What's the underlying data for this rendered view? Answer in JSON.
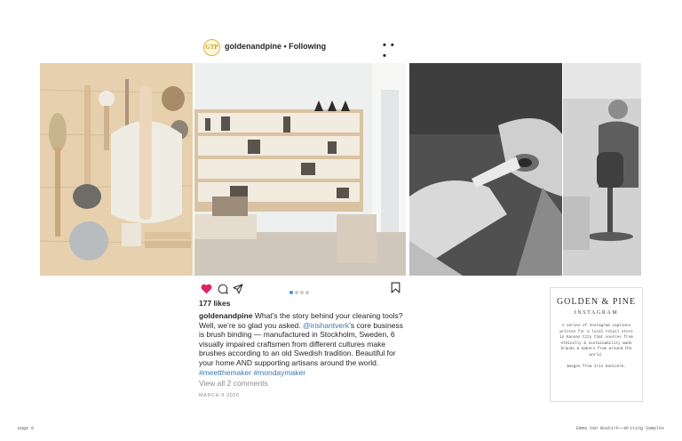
{
  "post": {
    "avatar_text": "GTP",
    "username": "goldenandpine",
    "follow_status": "Following",
    "more_label": "• • •",
    "photos": [
      "brushes flat-lay",
      "brush shop shelves",
      "hands binding brush",
      "craftsman at work"
    ],
    "likes": "177 likes",
    "caption": {
      "username": "goldenandpine",
      "text_1": " What’s the story behind your cleaning tools? Well, we’re so glad you asked. ",
      "mention": "@irishantverk",
      "text_2": "’s core business is brush binding — manufactured in Stockholm, Sweden, 6 visually impaired craftsmen from different cultures make brushes according to an old Swedish tradition. Beautiful for your home AND supporting artisans around the world.",
      "hashtag_1": "#meetthemaker",
      "hashtag_2": "#mondaymaker"
    },
    "view_comments": "View all 2 comments",
    "date": "MARCH 9 2020",
    "icons": {
      "like": "heart-icon",
      "comment": "comment-icon",
      "share": "share-icon",
      "save": "bookmark-icon"
    },
    "colors": {
      "heart": "#e0245e",
      "link": "#3a78b5",
      "active_dot": "#4a8fd6"
    }
  },
  "card": {
    "title": "GOLDEN & PINE",
    "subtitle": "INSTAGRAM",
    "body": "A series of Instagram captions written for a local retail store in Kansas City that sources from ethically & sustainability made brands & makers from around the world.",
    "credit": "Images from Iris Hantverk."
  },
  "footer": {
    "page": "page 8",
    "author": "Emma Van Buskirk——Writing Samples"
  }
}
